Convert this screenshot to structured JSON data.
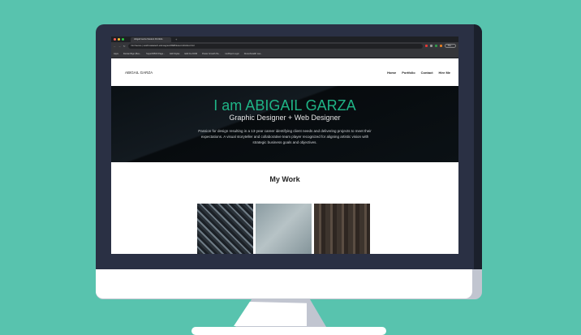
{
  "colors": {
    "background": "#58c3ae",
    "bezel": "#2a3044",
    "accent": "#1fb486",
    "hero": "#0b1115"
  },
  "browser": {
    "tab_title": "Abigail Garza Student Portfolio",
    "url_security": "Not Secure",
    "url": "wstd3.wakatech.edu/vagrant/WEB/lesson11/index.html",
    "profile_label": "Pau...",
    "bookmarks": [
      "Apps",
      "DeviantSign (Bes...",
      "Superb5500 Page...",
      "Edit Styles",
      "Edit the DOM",
      "Power Growth Pa...",
      "HubSpot Login",
      "Duren/Health Lea..."
    ]
  },
  "site": {
    "logo": "ABIGAIL GARZA",
    "nav": [
      "Home",
      "Portfolio",
      "Contact",
      "Hire Me"
    ],
    "hero": {
      "title": "I am ABIGAIL GARZA",
      "subtitle": "Graphic Designer + Web Designer",
      "description": "Passion for design resulting in a 13-year career identifying client needs and delivering projects to meet their expectations. A visual storyteller and collaborative team player recognized for aligning artistic vision with strategic business goals and objectives."
    },
    "work": {
      "title": "My Work",
      "images": [
        "letterpress-type",
        "gray-texture",
        "wood-planks"
      ]
    }
  }
}
